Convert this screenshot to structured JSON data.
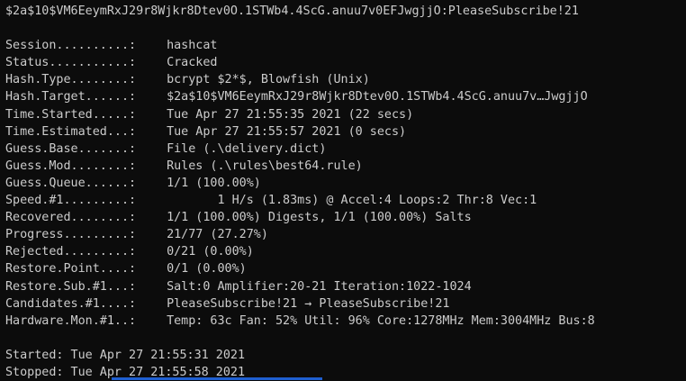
{
  "header_line": "$2a$10$VM6EeymRxJ29r8Wjkr8Dtev0O.1STWb4.4ScG.anuu7v0EFJwgjjO:PleaseSubscribe!21",
  "status_rows": [
    {
      "key": "Session..........:",
      "value": "hashcat"
    },
    {
      "key": "Status...........:",
      "value": "Cracked"
    },
    {
      "key": "Hash.Type........:",
      "value": "bcrypt $2*$, Blowfish (Unix)"
    },
    {
      "key": "Hash.Target......:",
      "value": "$2a$10$VM6EeymRxJ29r8Wjkr8Dtev0O.1STWb4.4ScG.anuu7v…JwgjjO"
    },
    {
      "key": "Time.Started.....:",
      "value": "Tue Apr 27 21:55:35 2021 (22 secs)"
    },
    {
      "key": "Time.Estimated...:",
      "value": "Tue Apr 27 21:55:57 2021 (0 secs)"
    },
    {
      "key": "Guess.Base.......:",
      "value": "File (.\\delivery.dict)"
    },
    {
      "key": "Guess.Mod........:",
      "value": "Rules (.\\rules\\best64.rule)"
    },
    {
      "key": "Guess.Queue......:",
      "value": "1/1 (100.00%)"
    },
    {
      "key": "Speed.#1.........:",
      "value": "       1 H/s (1.83ms) @ Accel:4 Loops:2 Thr:8 Vec:1"
    },
    {
      "key": "Recovered........:",
      "value": "1/1 (100.00%) Digests, 1/1 (100.00%) Salts"
    },
    {
      "key": "Progress.........:",
      "value": "21/77 (27.27%)"
    },
    {
      "key": "Rejected.........:",
      "value": "0/21 (0.00%)"
    },
    {
      "key": "Restore.Point....:",
      "value": "0/1 (0.00%)"
    },
    {
      "key": "Restore.Sub.#1...:",
      "value": "Salt:0 Amplifier:20-21 Iteration:1022-1024"
    },
    {
      "key": "Candidates.#1....:",
      "value": "PleaseSubscribe!21 → PleaseSubscribe!21"
    },
    {
      "key": "Hardware.Mon.#1..:",
      "value": "Temp: 63c Fan: 52% Util: 96% Core:1278MHz Mem:3004MHz Bus:8"
    }
  ],
  "footer": {
    "started": "Started: Tue Apr 27 21:55:31 2021",
    "stopped": "Stopped: Tue Apr 27 21:55:58 2021"
  },
  "colors": {
    "background": "#0c0c0c",
    "text": "#cccccc",
    "selection": "#1f5fd1"
  }
}
